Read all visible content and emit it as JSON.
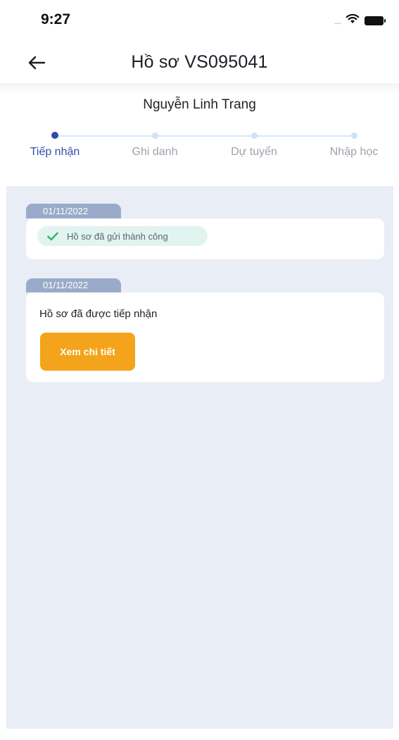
{
  "status_bar": {
    "time": "9:27",
    "signal_dots": "....",
    "icons": [
      "wifi-icon",
      "battery-icon"
    ]
  },
  "header": {
    "back_icon": "arrow-left-icon",
    "title": "Hồ sơ VS095041"
  },
  "applicant": {
    "name": "Nguyễn Linh Trang"
  },
  "steps": [
    {
      "label": "Tiếp nhận",
      "active": true
    },
    {
      "label": "Ghi danh",
      "active": false
    },
    {
      "label": "Dự tuyển",
      "active": false
    },
    {
      "label": "Nhập học",
      "active": false
    }
  ],
  "timeline": [
    {
      "date": "01/11/2022",
      "status_chip": {
        "icon": "checkmark-icon",
        "text": "Hồ sơ đã gửi thành công"
      }
    },
    {
      "date": "01/11/2022",
      "message": "Hồ sơ đã được tiếp nhận",
      "button_label": "Xem chi tiết"
    }
  ],
  "colors": {
    "accent_blue": "#2b4fa8",
    "step_inactive": "#cfe2f8",
    "date_tag": "#9aabc9",
    "success_chip_bg": "#e2f4ef",
    "success_check": "#3bb273",
    "button_orange": "#f3a41a",
    "content_bg": "#e9edf6"
  }
}
